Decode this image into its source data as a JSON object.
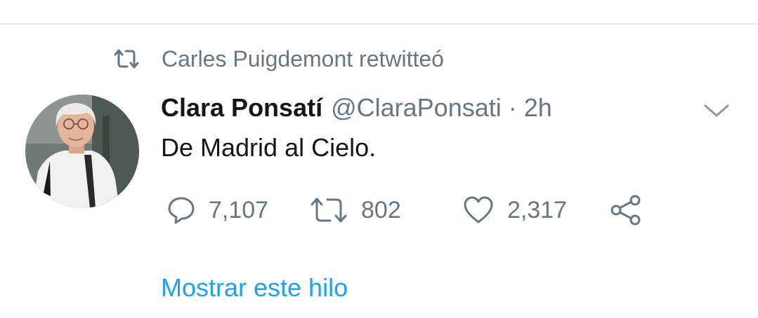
{
  "retweet_context": {
    "icon": "retweet-icon",
    "text": "Carles Puigdemont retwitteó"
  },
  "tweet": {
    "avatar": "avatar",
    "author_name": "Clara Ponsatí",
    "author_handle": "@ClaraPonsati",
    "separator": "·",
    "timestamp": "2h",
    "text": "De Madrid al Cielo.",
    "menu_icon": "chevron-down-icon"
  },
  "actions": {
    "reply": {
      "icon": "reply-icon",
      "count": "7,107"
    },
    "retweet": {
      "icon": "retweet-icon",
      "count": "802"
    },
    "like": {
      "icon": "heart-icon",
      "count": "2,317"
    },
    "share": {
      "icon": "share-icon"
    }
  },
  "show_thread": {
    "label": "Mostrar este hilo"
  },
  "colors": {
    "text_primary": "#14171a",
    "text_secondary": "#657786",
    "link": "#1da1f2",
    "divider": "#e6ecf0"
  }
}
